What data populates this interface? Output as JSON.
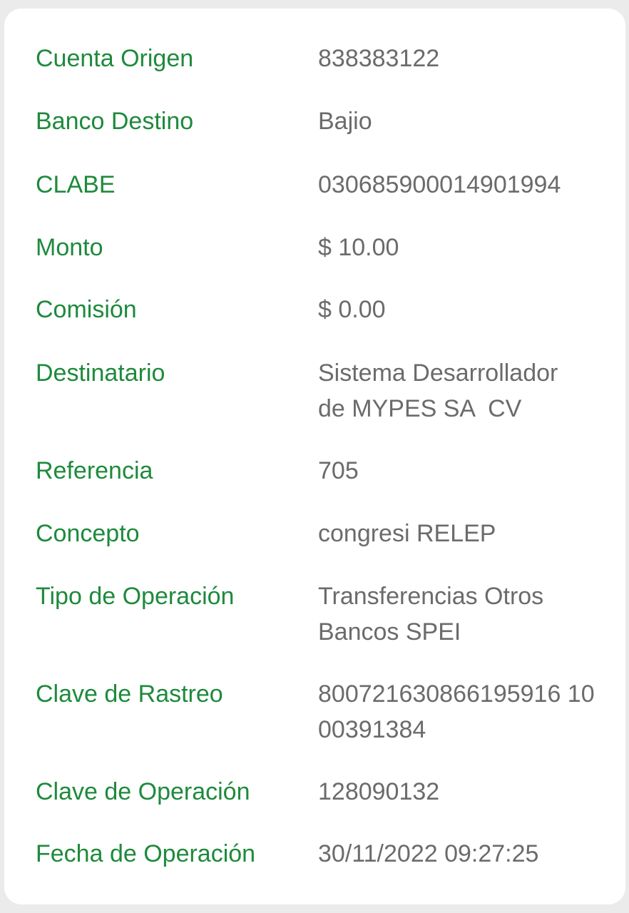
{
  "colors": {
    "label": "#1e8a3c",
    "value": "#6b6b6b",
    "card_bg": "#ffffff",
    "page_bg": "#ebebeb"
  },
  "details": {
    "cuenta_origen": {
      "label": "Cuenta Origen",
      "value": [
        "838383122"
      ]
    },
    "banco_destino": {
      "label": "Banco Destino",
      "value": [
        "Bajio"
      ]
    },
    "clabe": {
      "label": "CLABE",
      "value": [
        "030685900014901994"
      ]
    },
    "monto": {
      "label": "Monto",
      "value": [
        "$ 10.00"
      ]
    },
    "comision": {
      "label": "Comisión",
      "value": [
        "$ 0.00"
      ]
    },
    "destinatario": {
      "label": "Destinatario",
      "value": [
        "Sistema Desarrollador",
        "de MYPES SA  CV"
      ]
    },
    "referencia": {
      "label": "Referencia",
      "value": [
        "705"
      ]
    },
    "concepto": {
      "label": "Concepto",
      "value": [
        "congresi RELEP"
      ]
    },
    "tipo_operacion": {
      "label": "Tipo de Operación",
      "value": [
        "Transferencias Otros",
        "Bancos SPEI"
      ]
    },
    "clave_rastreo": {
      "label": "Clave de Rastreo",
      "value": [
        "800721630866195916 10",
        "00391384"
      ]
    },
    "clave_operacion": {
      "label": "Clave de Operación",
      "value": [
        "128090132"
      ]
    },
    "fecha_operacion": {
      "label": "Fecha de Operación",
      "value": [
        "30/11/2022 09:27:25"
      ]
    }
  }
}
